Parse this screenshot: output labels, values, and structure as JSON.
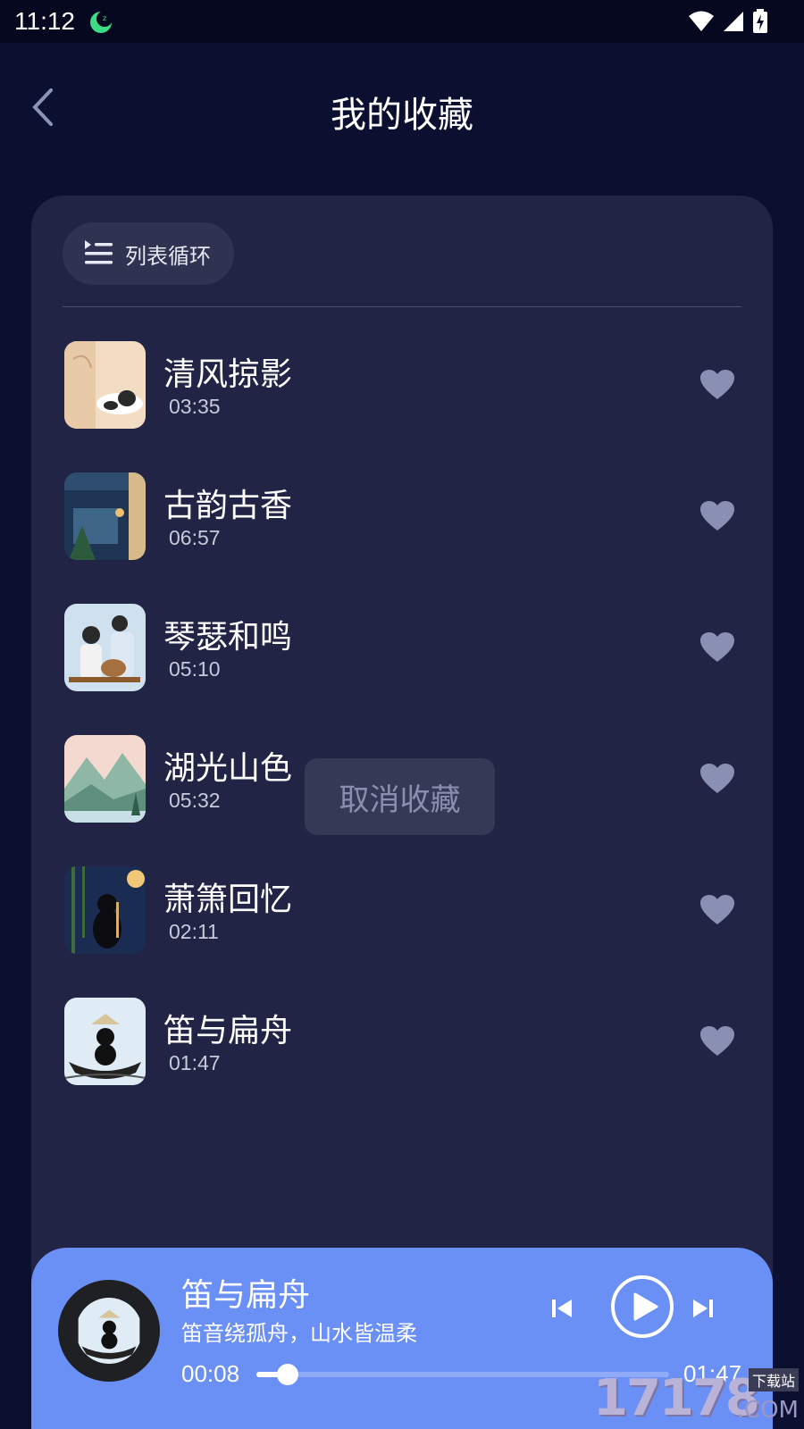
{
  "status_bar": {
    "time": "11:12",
    "icons": [
      "moon-sleep-icon",
      "wifi-icon",
      "signal-icon",
      "battery-charging-icon"
    ]
  },
  "header": {
    "title": "我的收藏",
    "back_icon": "chevron-left-icon"
  },
  "playlist": {
    "mode_label": "列表循环",
    "mode_icon": "list-loop-icon",
    "songs": [
      {
        "title": "清风掠影",
        "duration": "03:35",
        "favorited": true
      },
      {
        "title": "古韵古香",
        "duration": "06:57",
        "favorited": true
      },
      {
        "title": "琴瑟和鸣",
        "duration": "05:10",
        "favorited": true
      },
      {
        "title": "湖光山色",
        "duration": "05:32",
        "favorited": true
      },
      {
        "title": "萧箫回忆",
        "duration": "02:11",
        "favorited": true
      },
      {
        "title": "笛与扁舟",
        "duration": "01:47",
        "favorited": true
      }
    ]
  },
  "tooltip": {
    "label": "取消收藏"
  },
  "player": {
    "title": "笛与扁舟",
    "subtitle": "笛音绕孤舟，山水皆温柔",
    "current_time": "00:08",
    "total_time": "01:47",
    "progress": 0.075,
    "controls": [
      "previous-icon",
      "play-icon",
      "next-icon"
    ]
  },
  "watermark": {
    "number": "17178",
    "tag": "下载站",
    "domain": ".COM"
  },
  "colors": {
    "background": "#0c1030",
    "card": "#212444",
    "player": "#6a8ff5",
    "heart": "#8a90b4"
  }
}
